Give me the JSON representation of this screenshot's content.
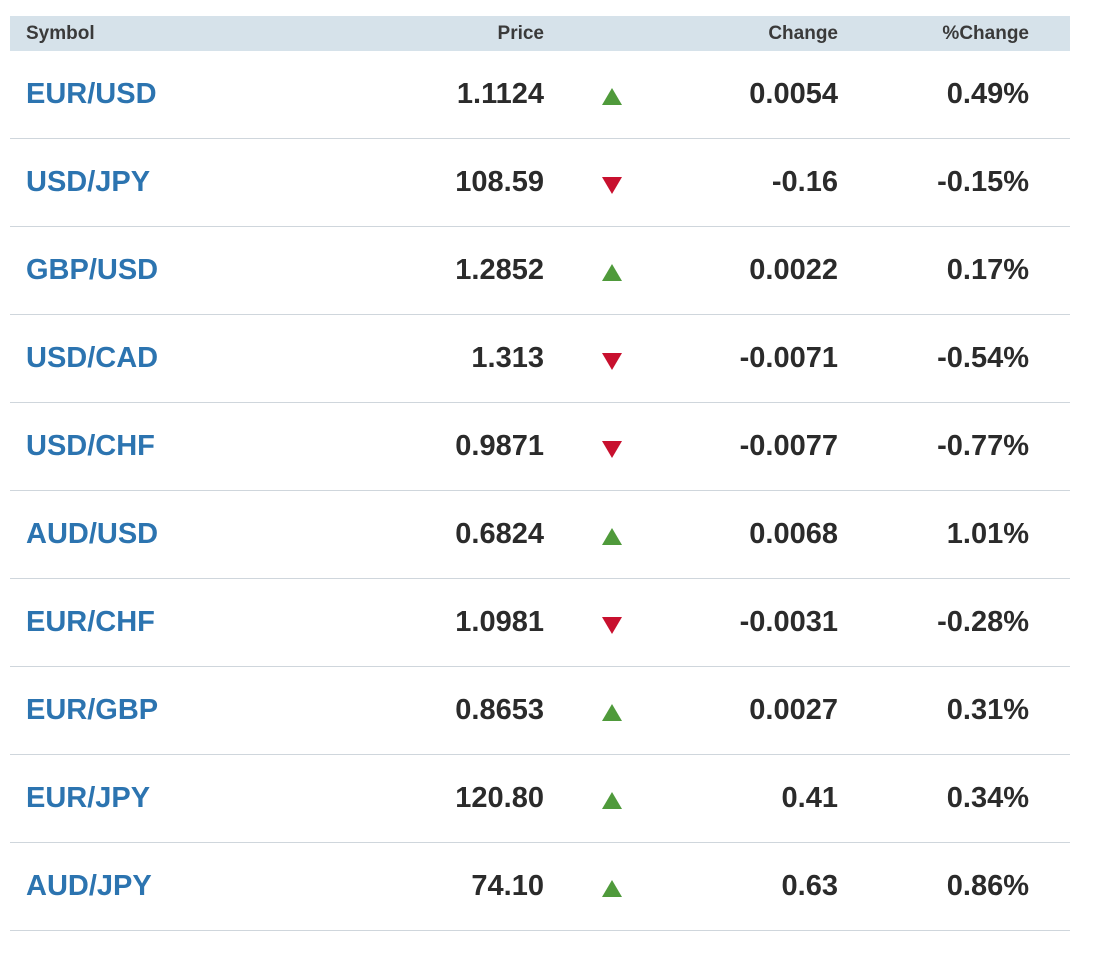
{
  "header": {
    "symbol": "Symbol",
    "price": "Price",
    "change": "Change",
    "pct_change": "%Change"
  },
  "colors": {
    "up": "#4f9a3b",
    "down": "#c8102e",
    "link": "#2c74b0",
    "header_bg": "#d6e2ea"
  },
  "rows": [
    {
      "symbol": "EUR/USD",
      "price": "1.1124",
      "direction": "up",
      "change": "0.0054",
      "pct_change": "0.49%"
    },
    {
      "symbol": "USD/JPY",
      "price": "108.59",
      "direction": "down",
      "change": "-0.16",
      "pct_change": "-0.15%"
    },
    {
      "symbol": "GBP/USD",
      "price": "1.2852",
      "direction": "up",
      "change": "0.0022",
      "pct_change": "0.17%"
    },
    {
      "symbol": "USD/CAD",
      "price": "1.313",
      "direction": "down",
      "change": "-0.0071",
      "pct_change": "-0.54%"
    },
    {
      "symbol": "USD/CHF",
      "price": "0.9871",
      "direction": "down",
      "change": "-0.0077",
      "pct_change": "-0.77%"
    },
    {
      "symbol": "AUD/USD",
      "price": "0.6824",
      "direction": "up",
      "change": "0.0068",
      "pct_change": "1.01%"
    },
    {
      "symbol": "EUR/CHF",
      "price": "1.0981",
      "direction": "down",
      "change": "-0.0031",
      "pct_change": "-0.28%"
    },
    {
      "symbol": "EUR/GBP",
      "price": "0.8653",
      "direction": "up",
      "change": "0.0027",
      "pct_change": "0.31%"
    },
    {
      "symbol": "EUR/JPY",
      "price": "120.80",
      "direction": "up",
      "change": "0.41",
      "pct_change": "0.34%"
    },
    {
      "symbol": "AUD/JPY",
      "price": "74.10",
      "direction": "up",
      "change": "0.63",
      "pct_change": "0.86%"
    }
  ]
}
